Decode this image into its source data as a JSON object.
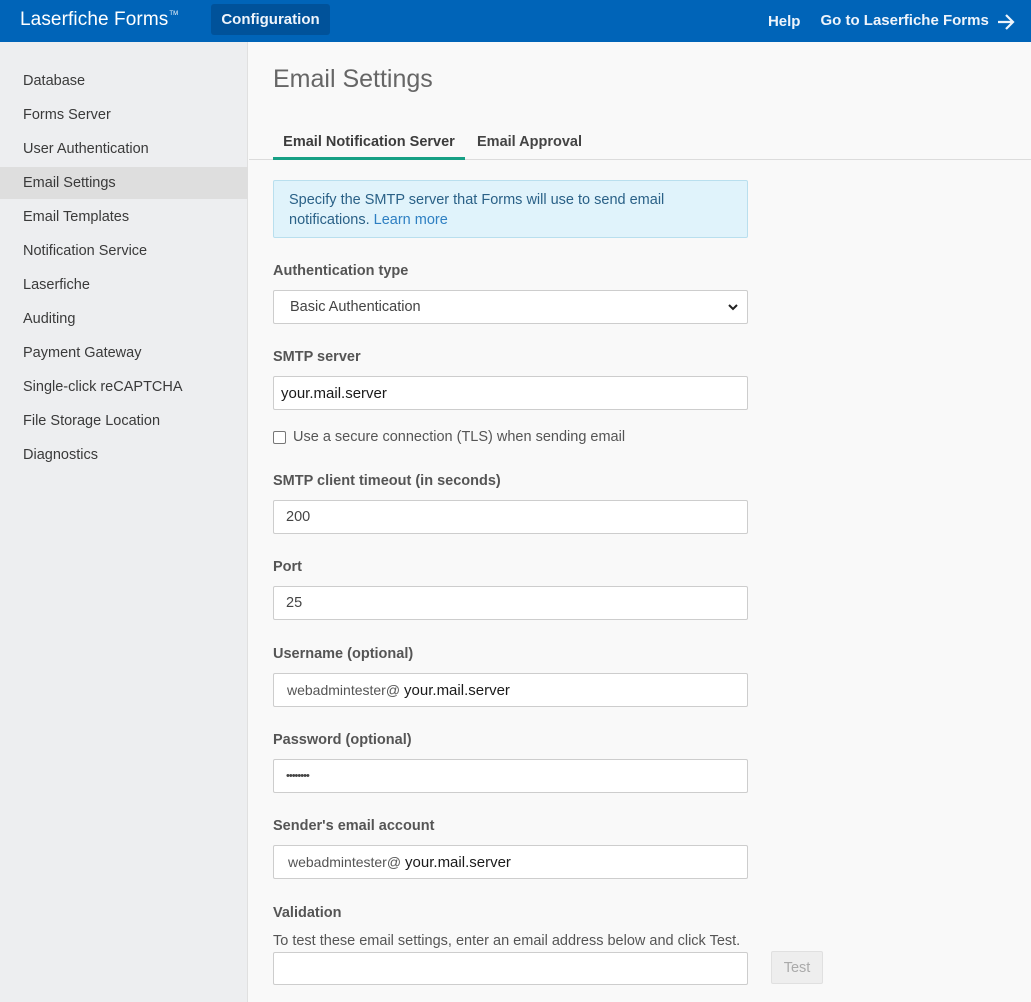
{
  "header": {
    "brand": "Laserfiche Forms",
    "brand_tm": "TM",
    "config_label": "Configuration",
    "help_label": "Help",
    "goto_label": "Go to Laserfiche Forms",
    "goto_icon": "arrow-right-icon",
    "bar_color": "#0064b8"
  },
  "sidebar": {
    "items": [
      {
        "label": "Database"
      },
      {
        "label": "Forms Server"
      },
      {
        "label": "User Authentication"
      },
      {
        "label": "Email Settings",
        "active": true
      },
      {
        "label": "Email Templates"
      },
      {
        "label": "Notification Service"
      },
      {
        "label": "Laserfiche"
      },
      {
        "label": "Auditing"
      },
      {
        "label": "Payment Gateway"
      },
      {
        "label": "Single-click reCAPTCHA"
      },
      {
        "label": "File Storage Location"
      },
      {
        "label": "Diagnostics"
      }
    ]
  },
  "main": {
    "title": "Email Settings",
    "tabs": [
      {
        "label": "Email Notification Server",
        "active": true
      },
      {
        "label": "Email Approval"
      }
    ],
    "info": {
      "text": "Specify the SMTP server that Forms will use to send email notifications.",
      "link": "Learn more"
    },
    "form": {
      "auth_type_label": "Authentication type",
      "auth_type_value": "Basic Authentication",
      "smtp_server_label": "SMTP server",
      "smtp_server_value": "your.mail.server",
      "tls_label": "Use a secure connection (TLS) when sending email",
      "tls_checked": false,
      "timeout_label": "SMTP client timeout (in seconds)",
      "timeout_value": "200",
      "port_label": "Port",
      "port_value": "25",
      "username_label": "Username (optional)",
      "username_prefix": "webadmintester@",
      "username_domain": "your.mail.server",
      "password_label": "Password (optional)",
      "password_value": "••••••••",
      "sender_label": "Sender's email account",
      "sender_prefix": "webadmintester@",
      "sender_domain": "your.mail.server",
      "validation_label": "Validation",
      "validation_help": "To test these email settings, enter an email address below and click Test.",
      "validation_value": "",
      "test_label": "Test"
    }
  }
}
